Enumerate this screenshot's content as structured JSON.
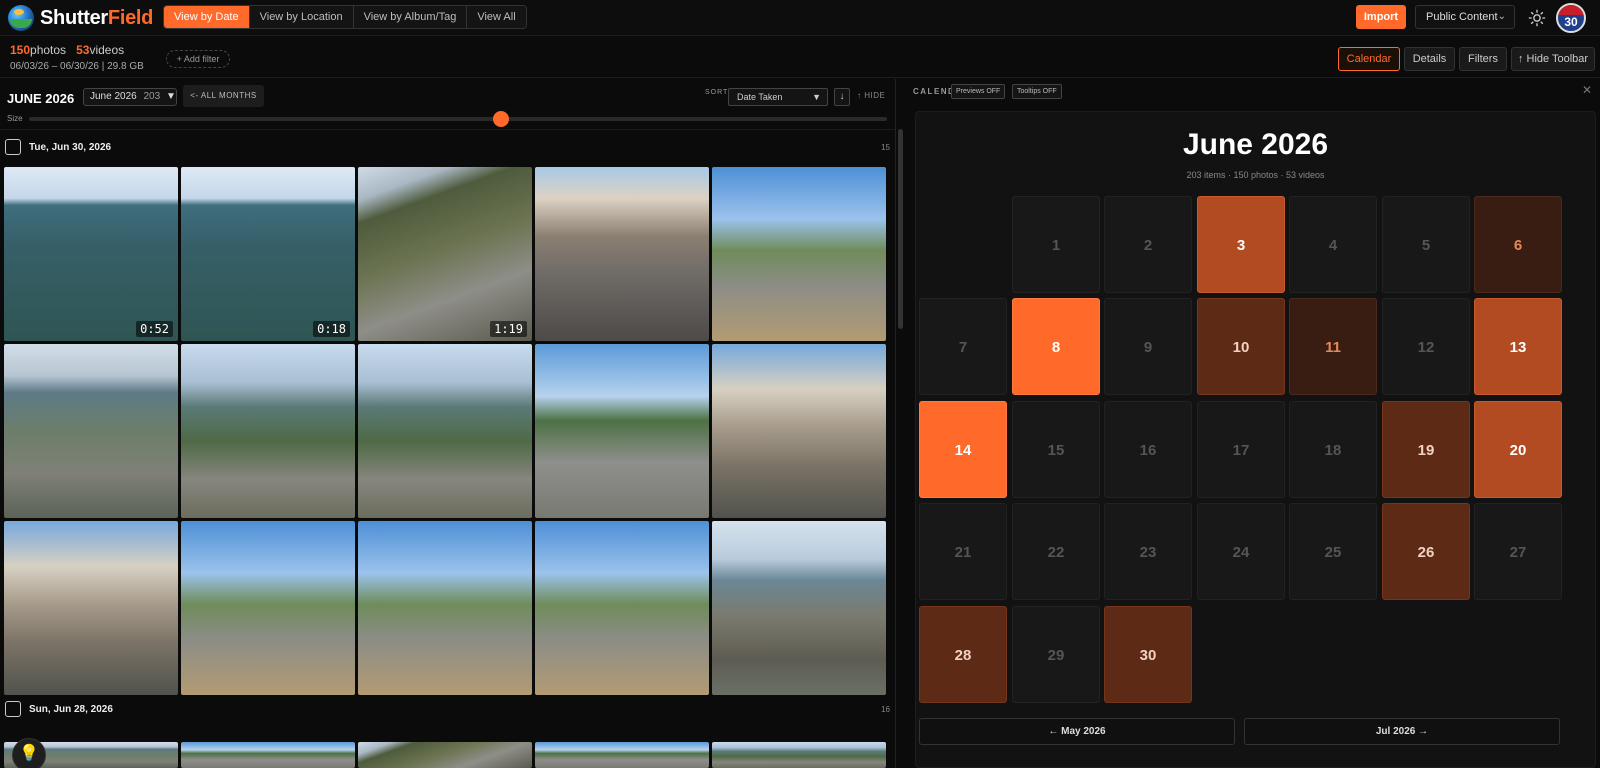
{
  "app": {
    "logo_left": "Shutter",
    "logo_right": "Field"
  },
  "view_tabs": [
    {
      "label": "View by Date",
      "active": true
    },
    {
      "label": "View by Location",
      "active": false
    },
    {
      "label": "View by Album/Tag",
      "active": false
    },
    {
      "label": "View All",
      "active": false
    }
  ],
  "toolbar": {
    "import_label": "Import",
    "content_select": "Public Content",
    "avatar_badge": "30"
  },
  "stats": {
    "photos_count": "150",
    "photos_label": "photos",
    "videos_count": "53",
    "videos_label": "videos",
    "range": "06/03/26 – 06/30/26 | 29.8 GB",
    "add_filter": "+ Add filter"
  },
  "right_buttons": {
    "calendar": "Calendar",
    "details": "Details",
    "filters": "Filters",
    "hide_toolbar": "↑ Hide Toolbar"
  },
  "left_header": {
    "month_title": "JUNE 2026",
    "month_select": "June 2026",
    "month_count": "203",
    "all_months": "<- ALL MONTHS",
    "sort_label": "SORT",
    "sort_value": "Date Taken",
    "hide": "↑ HIDE",
    "size_label": "Size",
    "size_value": 0.55
  },
  "groups": [
    {
      "date": "Tue, Jun 30, 2026",
      "count": "15"
    },
    {
      "date": "Sun, Jun 28, 2026",
      "count": "16"
    }
  ],
  "thumbs": [
    {
      "duration": "0:52",
      "scene": "bridge"
    },
    {
      "duration": "0:18",
      "scene": "bridge"
    },
    {
      "duration": "1:19",
      "scene": "highway-construction"
    },
    {
      "duration": "",
      "scene": "parking-buildings"
    },
    {
      "duration": "",
      "scene": "highway-flag"
    },
    {
      "duration": "",
      "scene": "lake-highway"
    },
    {
      "duration": "",
      "scene": "bridge-approach"
    },
    {
      "duration": "",
      "scene": "bridge-approach"
    },
    {
      "duration": "",
      "scene": "lot-suburb"
    },
    {
      "duration": "",
      "scene": "building-town"
    },
    {
      "duration": "",
      "scene": "building-town"
    },
    {
      "duration": "",
      "scene": "highway-flag"
    },
    {
      "duration": "",
      "scene": "highway-flag"
    },
    {
      "duration": "",
      "scene": "highway-flag"
    },
    {
      "duration": "",
      "scene": "bridge-water"
    }
  ],
  "calendar": {
    "header_label": "CALENDAR",
    "previews_chip": "Previews OFF",
    "tooltips_chip": "Tooltips OFF",
    "title": "June 2026",
    "subtitle": "203 items · 150 photos · 53 videos",
    "prev_month": "← May 2026",
    "next_month": "Jul 2026 →",
    "days": [
      {
        "d": "1",
        "level": 0
      },
      {
        "d": "2",
        "level": 0
      },
      {
        "d": "3",
        "level": 3
      },
      {
        "d": "4",
        "level": 0
      },
      {
        "d": "5",
        "level": 0
      },
      {
        "d": "6",
        "level": 1
      },
      {
        "d": "7",
        "level": 0
      },
      {
        "d": "8",
        "level": 4
      },
      {
        "d": "9",
        "level": 0
      },
      {
        "d": "10",
        "level": 2
      },
      {
        "d": "11",
        "level": 1
      },
      {
        "d": "12",
        "level": 0
      },
      {
        "d": "13",
        "level": 3
      },
      {
        "d": "14",
        "level": 4
      },
      {
        "d": "15",
        "level": 0
      },
      {
        "d": "16",
        "level": 0
      },
      {
        "d": "17",
        "level": 0
      },
      {
        "d": "18",
        "level": 0
      },
      {
        "d": "19",
        "level": 2
      },
      {
        "d": "20",
        "level": 3
      },
      {
        "d": "21",
        "level": 0
      },
      {
        "d": "22",
        "level": 0
      },
      {
        "d": "23",
        "level": 0
      },
      {
        "d": "24",
        "level": 0
      },
      {
        "d": "25",
        "level": 0
      },
      {
        "d": "26",
        "level": 2
      },
      {
        "d": "27",
        "level": 0
      },
      {
        "d": "28",
        "level": 2
      },
      {
        "d": "29",
        "level": 0
      },
      {
        "d": "30",
        "level": 2
      }
    ]
  }
}
